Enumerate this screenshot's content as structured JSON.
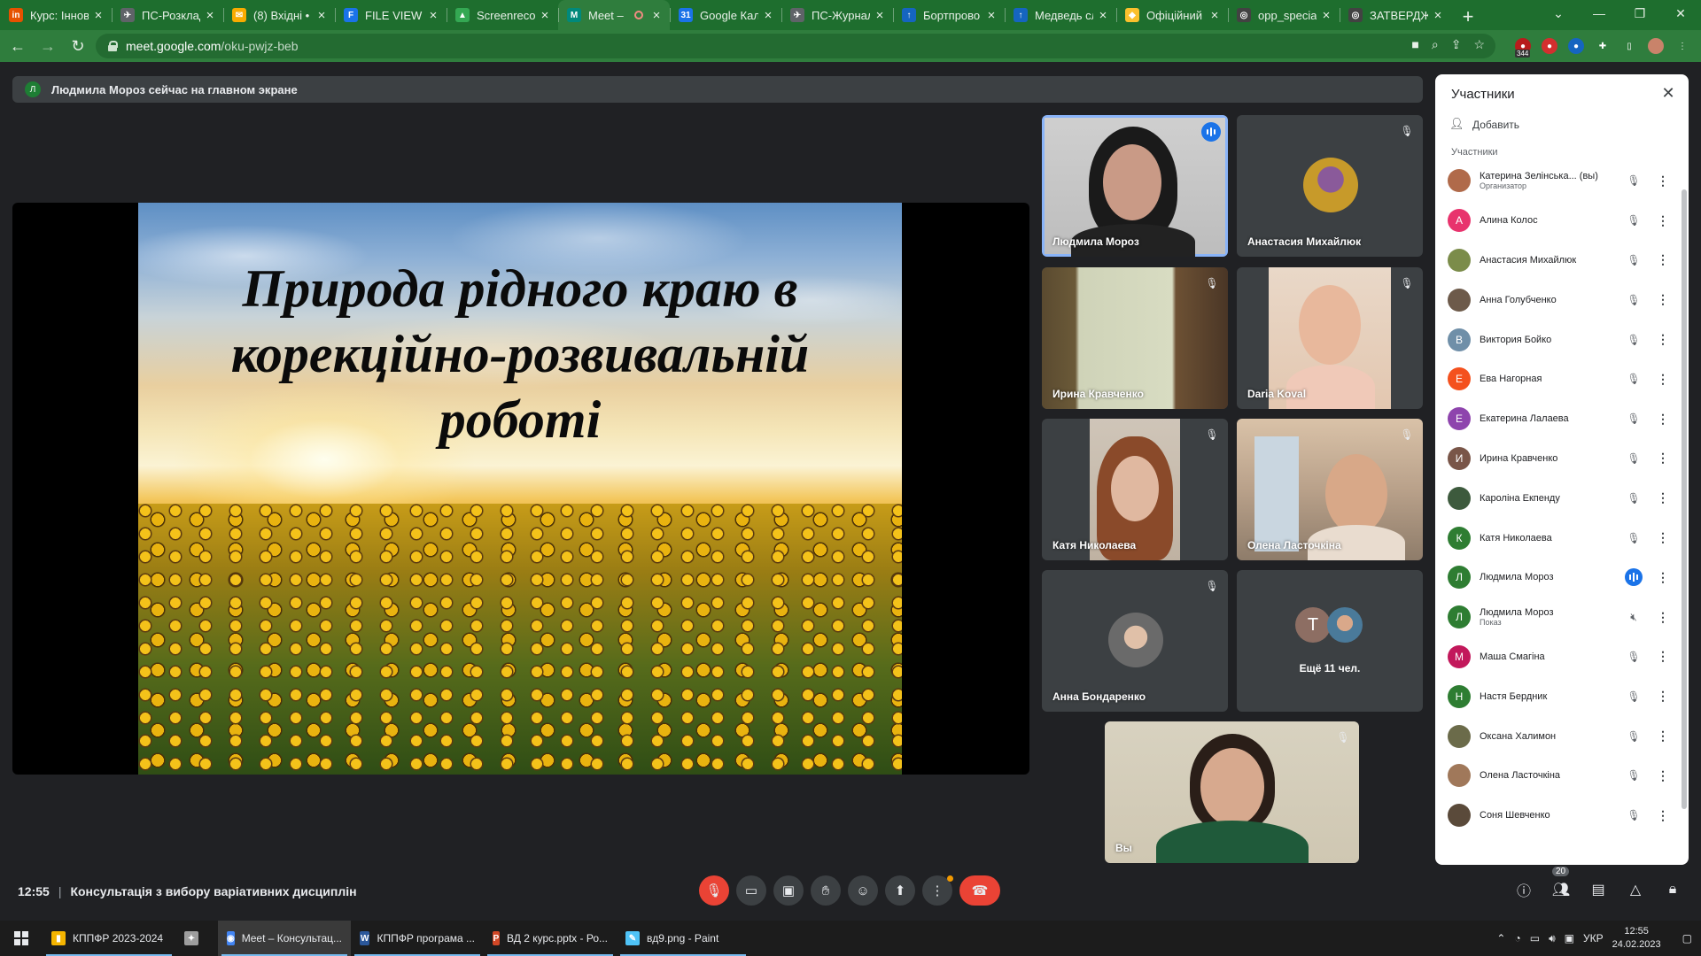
{
  "browser": {
    "tabs": [
      {
        "label": "Курс: Іннова",
        "color": "#e65100",
        "glyph": "in"
      },
      {
        "label": "ПС-Розклад",
        "color": "#5f6368",
        "glyph": "✈"
      },
      {
        "label": "(8) Вхідні •",
        "color": "#f9ab00",
        "glyph": "✉"
      },
      {
        "label": "FILE VIEW",
        "color": "#1a73e8",
        "glyph": "F"
      },
      {
        "label": "Screenreco",
        "color": "#34a853",
        "glyph": "▲"
      },
      {
        "label": "Meet –",
        "color": "#00897b",
        "glyph": "M",
        "active": true
      },
      {
        "label": "Google Кал",
        "color": "#1a73e8",
        "glyph": "31"
      },
      {
        "label": "ПС-Журнал",
        "color": "#5f6368",
        "glyph": "✈"
      },
      {
        "label": "Бортпрово",
        "color": "#1565c0",
        "glyph": "↑"
      },
      {
        "label": "Медведь сл",
        "color": "#1565c0",
        "glyph": "↑"
      },
      {
        "label": "Офіційний",
        "color": "#fbc02d",
        "glyph": "◆"
      },
      {
        "label": "opp_specia",
        "color": "#424242",
        "glyph": "◎"
      },
      {
        "label": "ЗАТВЕРДЖ",
        "color": "#424242",
        "glyph": "◎"
      }
    ],
    "url_host": "meet.google.com",
    "url_path": "/oku-pwjz-beb",
    "ext_badge": "344"
  },
  "meet": {
    "presenting_text": "Людмила Мороз сейчас на главном экране",
    "presenter_initial": "Л",
    "slide_title_lines": [
      "Природа рідного краю в",
      "корекційно-розвивальній",
      "роботі"
    ],
    "tiles": [
      {
        "name": "Людмила Мороз",
        "state": "speaking"
      },
      {
        "name": "Анастасия Михайлюк",
        "state": "muted"
      },
      {
        "name": "Ирина Кравченко",
        "state": "muted"
      },
      {
        "name": "Daria Koval",
        "state": "muted"
      },
      {
        "name": "Катя Николаева",
        "state": "muted"
      },
      {
        "name": "Олена Ласточкіна",
        "state": "muted"
      },
      {
        "name": "Анна Бондаренко",
        "state": "muted"
      },
      {
        "name": "Ещё 11 чел.",
        "state": "more",
        "initial": "Т"
      },
      {
        "name": "Вы",
        "state": "muted"
      }
    ],
    "time": "12:55",
    "meeting_title": "Консультація з вибору варіативних дисциплін",
    "people_count": "20"
  },
  "panel": {
    "title": "Участники",
    "add_label": "Добавить",
    "section_label": "Участники",
    "participants": [
      {
        "name": "Катерина Зелінська... (вы)",
        "role": "Организатор",
        "initial": "",
        "color": "#b06a4a",
        "mic": "muted"
      },
      {
        "name": "Алина Колос",
        "role": "",
        "initial": "А",
        "color": "#e8336d",
        "mic": "muted"
      },
      {
        "name": "Анастасия Михайлюк",
        "role": "",
        "initial": "",
        "color": "#7b8c4a",
        "mic": "muted"
      },
      {
        "name": "Анна Голубченко",
        "role": "",
        "initial": "",
        "color": "#6d5a4a",
        "mic": "muted"
      },
      {
        "name": "Виктория Бойко",
        "role": "",
        "initial": "В",
        "color": "#6f8fa8",
        "mic": "muted"
      },
      {
        "name": "Ева Нагорная",
        "role": "",
        "initial": "Е",
        "color": "#f4511e",
        "mic": "muted"
      },
      {
        "name": "Екатерина Лалаева",
        "role": "",
        "initial": "Е",
        "color": "#8e44ad",
        "mic": "muted"
      },
      {
        "name": "Ирина Кравченко",
        "role": "",
        "initial": "И",
        "color": "#795548",
        "mic": "muted"
      },
      {
        "name": "Кароліна Екпенду",
        "role": "",
        "initial": "",
        "color": "#3d5a3d",
        "mic": "muted"
      },
      {
        "name": "Катя Николаева",
        "role": "",
        "initial": "К",
        "color": "#2e7d32",
        "mic": "muted"
      },
      {
        "name": "Людмила Мороз",
        "role": "",
        "initial": "Л",
        "color": "#2e7d32",
        "mic": "talking"
      },
      {
        "name": "Людмила Мороз",
        "role": "Показ",
        "initial": "Л",
        "color": "#2e7d32",
        "mic": "sound-off"
      },
      {
        "name": "Маша Смагіна",
        "role": "",
        "initial": "М",
        "color": "#c2185b",
        "mic": "muted"
      },
      {
        "name": "Настя Бердник",
        "role": "",
        "initial": "Н",
        "color": "#2e7d32",
        "mic": "muted"
      },
      {
        "name": "Оксана Халимон",
        "role": "",
        "initial": "",
        "color": "#6b6b4a",
        "mic": "muted"
      },
      {
        "name": "Олена Ласточкіна",
        "role": "",
        "initial": "",
        "color": "#a0785a",
        "mic": "muted"
      },
      {
        "name": "Соня Шевченко",
        "role": "",
        "initial": "",
        "color": "#5a4a3a",
        "mic": "muted"
      }
    ]
  },
  "taskbar": {
    "items": [
      {
        "label": "КППФР 2023-2024",
        "icon_color": "#f4b400",
        "glyph": "▮",
        "state": "open"
      },
      {
        "label": "",
        "icon_color": "#9e9e9e",
        "glyph": "✦",
        "state": "none"
      },
      {
        "label": "Meet – Консультац...",
        "icon_color": "#4285f4",
        "glyph": "◉",
        "state": "current"
      },
      {
        "label": "КППФР програма ...",
        "icon_color": "#2b579a",
        "glyph": "W",
        "state": "open"
      },
      {
        "label": "ВД 2 курс.pptx - Ро...",
        "icon_color": "#d24726",
        "glyph": "P",
        "state": "open"
      },
      {
        "label": "вд9.png - Paint",
        "icon_color": "#4fc3f7",
        "glyph": "✎",
        "state": "open"
      }
    ],
    "lang": "УКР",
    "clock_time": "12:55",
    "clock_date": "24.02.2023"
  }
}
